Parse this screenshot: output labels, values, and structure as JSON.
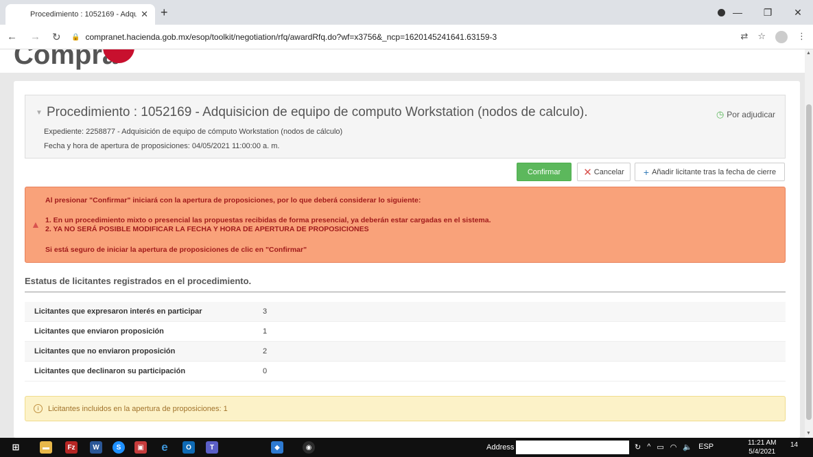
{
  "browser": {
    "tab_title": "Procedimiento : 1052169 - Adqu",
    "url": "compranet.hacienda.gob.mx/esop/toolkit/negotiation/rfq/awardRfq.do?wf=x3756&_ncp=1620145241641.63159-3"
  },
  "site": {
    "logo_text": "Compra"
  },
  "procedure": {
    "title": "Procedimiento : 1052169 - Adquisicion de equipo de computo Workstation (nodos de calculo).",
    "expediente": "Expediente: 2258877 - Adquisición de equipo de cómputo Workstation (nodos de cálculo)",
    "fecha": "Fecha y hora de apertura de proposiciones: 04/05/2021 11:00:00 a. m.",
    "status": "Por adjudicar"
  },
  "actions": {
    "confirm": "Confirmar",
    "cancel": "Cancelar",
    "add_bidder": "Añadir licitante tras la fecha de cierre"
  },
  "alert": {
    "line1": "Al presionar \"Confirmar\" iniciará con la apertura de proposiciones, por lo que deberá considerar lo siguiente:",
    "line2": "1. En un procedimiento mixto o presencial las propuestas recibidas de forma presencial, ya deberán estar cargadas en el sistema.",
    "line3": "2. YA NO SERÁ POSIBLE MODIFICAR LA FECHA Y HORA DE APERTURA DE PROPOSICIONES",
    "line4": "Si está seguro de iniciar la apertura de proposiciones de clic en \"Confirmar\""
  },
  "stats": {
    "title": "Estatus de licitantes registrados en el procedimiento.",
    "rows": [
      {
        "label": "Licitantes que expresaron interés en participar",
        "value": "3"
      },
      {
        "label": "Licitantes que enviaron proposición",
        "value": "1"
      },
      {
        "label": "Licitantes que no enviaron proposición",
        "value": "2"
      },
      {
        "label": "Licitantes que declinaron su participación",
        "value": "0"
      }
    ]
  },
  "info": {
    "text": "Licitantes incluidos en la apertura de proposiciones: 1"
  },
  "taskbar": {
    "address_label": "Address",
    "lang": "ESP",
    "time": "11:21 AM",
    "date": "5/4/2021",
    "notif_count": "14"
  },
  "colors": {
    "confirm_green": "#5cb85c",
    "alert_bg": "#f9a27a",
    "alert_text": "#a11b1b",
    "info_bg": "#fcf2c8"
  }
}
